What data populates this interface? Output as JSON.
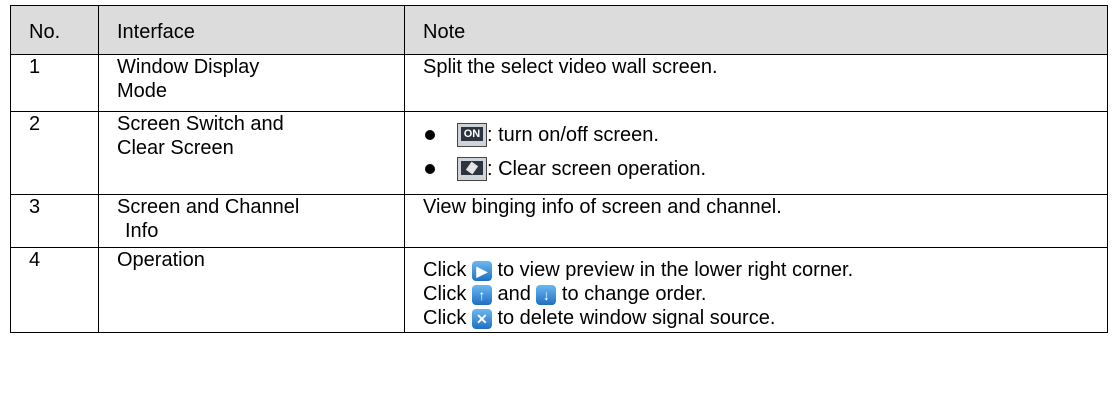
{
  "table": {
    "headers": [
      "No.",
      "Interface",
      "Note"
    ],
    "header_bg": "#dcdcdc",
    "rows": [
      {
        "no": "1",
        "interface": "Window Display Mode",
        "interface_lines": [
          "Window Display",
          "Mode"
        ],
        "note": "Split the select video wall screen."
      },
      {
        "no": "2",
        "interface_lines": [
          "Screen Switch and",
          "Clear Screen"
        ],
        "bullets": [
          {
            "icon": "screen-on-icon",
            "text": ": turn on/off screen."
          },
          {
            "icon": "clear-screen-icon",
            "text": ": Clear screen operation."
          }
        ]
      },
      {
        "no": "3",
        "interface_lines": [
          "Screen and Channel",
          "Info"
        ],
        "note": "View binging info of screen and channel."
      },
      {
        "no": "4",
        "interface_lines": [
          "Operation"
        ],
        "lines": [
          {
            "pre": "Click ",
            "icon": "play-preview-icon",
            "post": " to view preview in the lower right corner."
          },
          {
            "pre": "Click ",
            "icon": "arrow-up-icon",
            "mid": " and ",
            "icon2": "arrow-down-icon",
            "post": " to change order."
          },
          {
            "pre": "Click ",
            "icon": "delete-x-icon",
            "post": " to delete window signal source."
          }
        ]
      }
    ]
  }
}
